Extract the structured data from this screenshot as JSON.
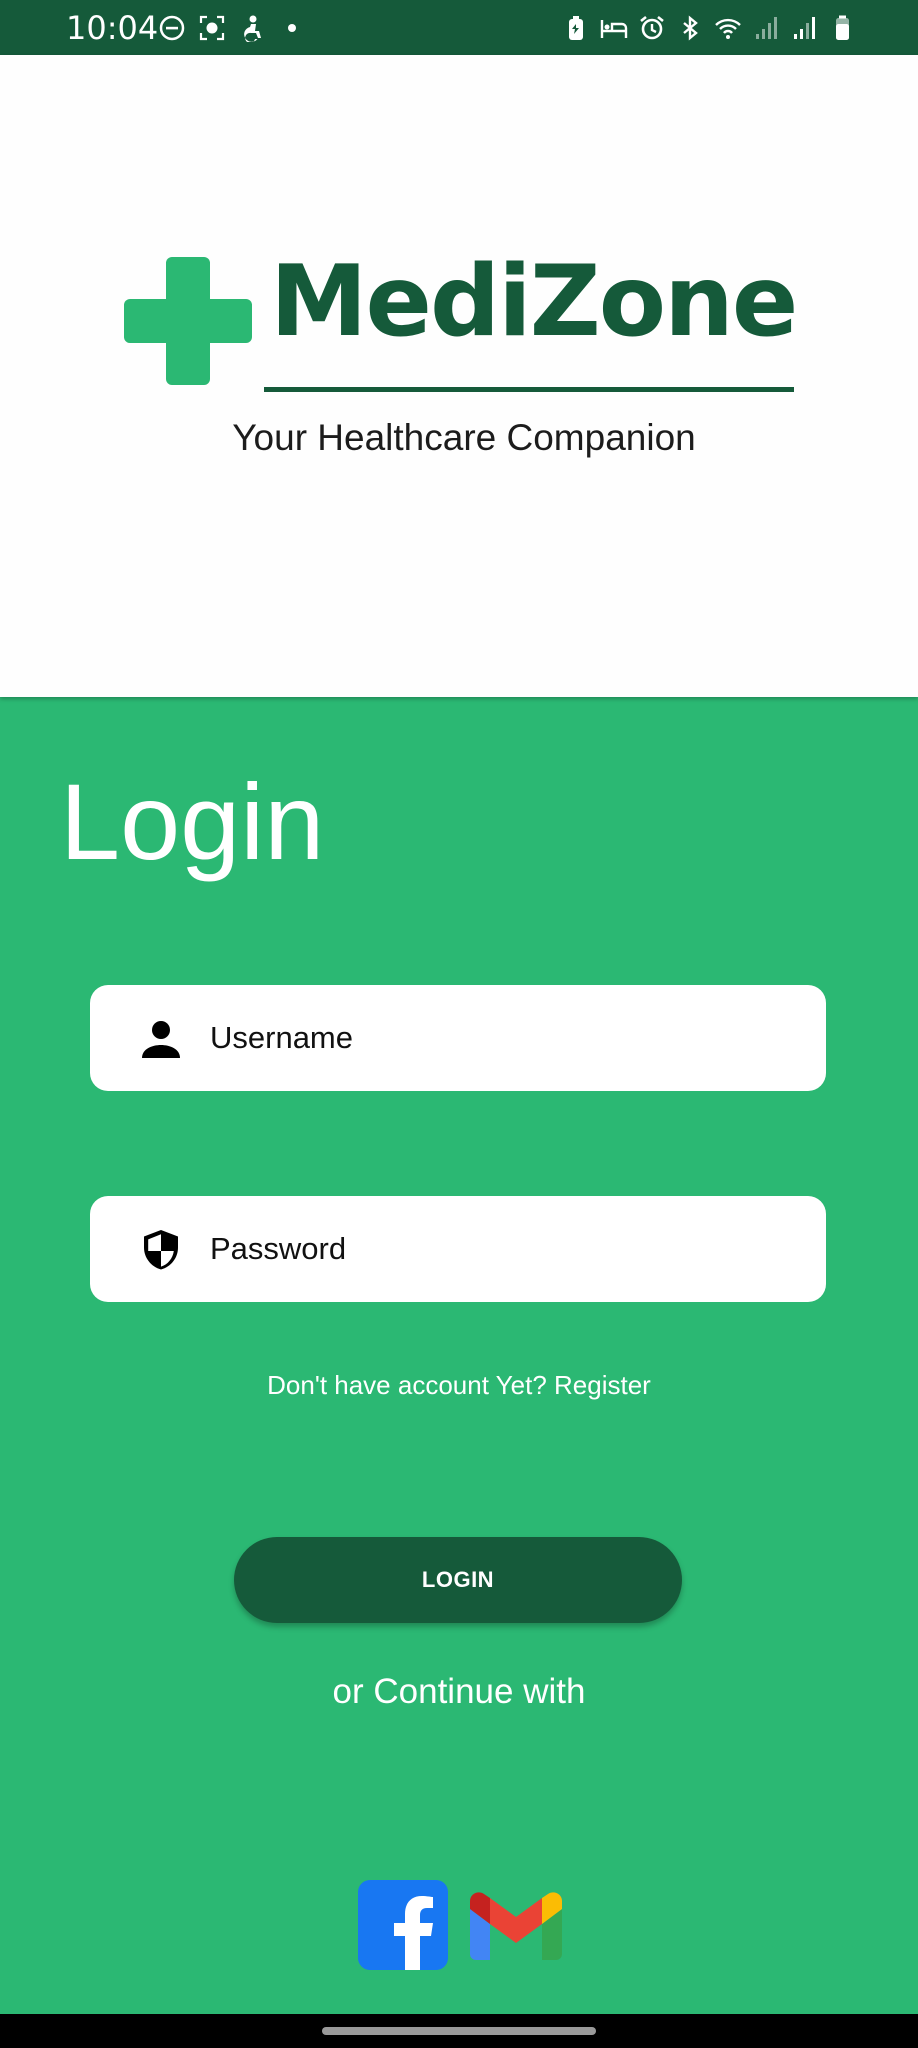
{
  "status_bar": {
    "time": "10:04",
    "left_icons": [
      "do-not-disturb-icon",
      "screenshot-icon",
      "accessibility-icon",
      "notification-dot-icon"
    ],
    "right_icons": [
      "battery-saver-icon",
      "bed-icon",
      "alarm-icon",
      "bluetooth-icon",
      "wifi-icon",
      "signal-1-icon",
      "signal-2-icon",
      "battery-icon"
    ]
  },
  "header": {
    "brand_name": "MediZone",
    "tagline": "Your Healthcare Companion"
  },
  "login": {
    "title": "Login",
    "username_placeholder": "Username",
    "password_placeholder": "Password",
    "register_text": "Don't have account Yet? Register",
    "login_button": "LOGIN",
    "continue_with": "or Continue with"
  },
  "social": [
    "facebook-icon",
    "gmail-icon"
  ],
  "colors": {
    "brand_dark": "#155a3a",
    "brand_green": "#2bb873",
    "white": "#ffffff"
  }
}
